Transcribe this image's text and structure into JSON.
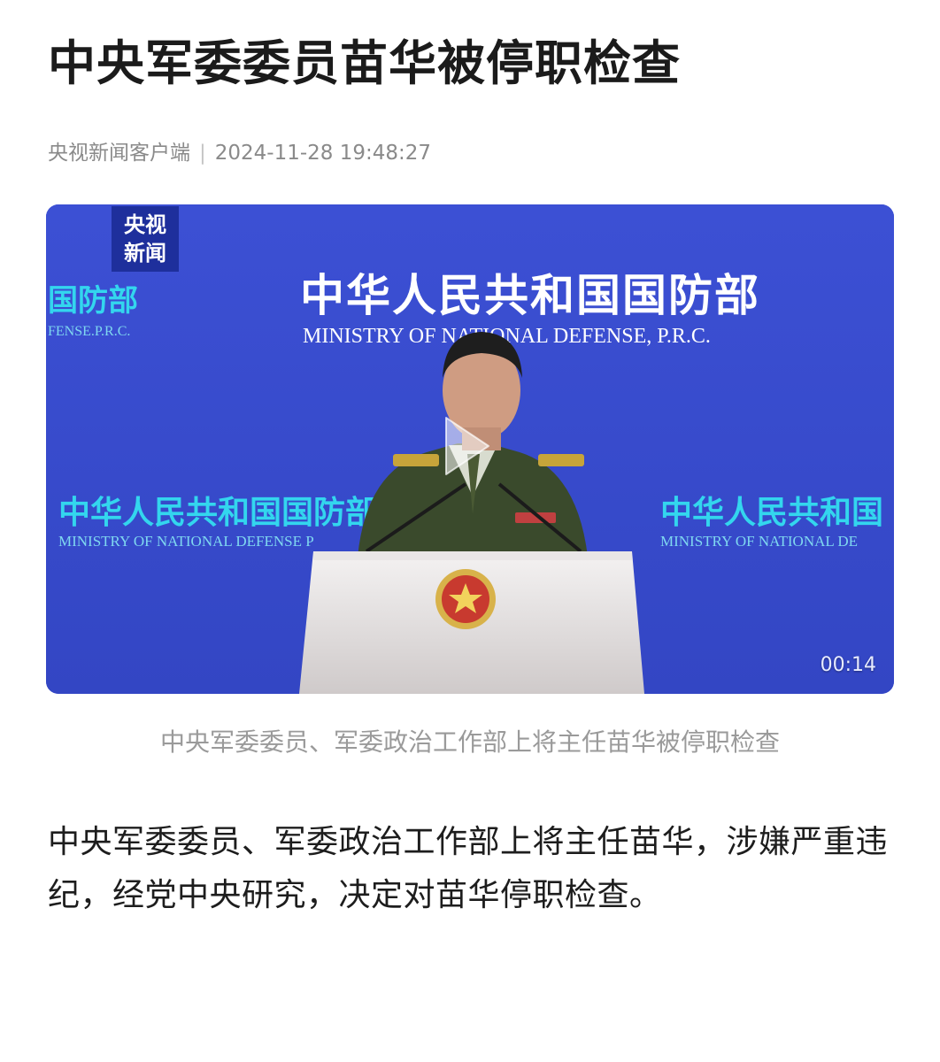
{
  "article": {
    "title": "中央军委委员苗华被停职检查",
    "source": "央视新闻客户端",
    "separator": "|",
    "timestamp": "2024-11-28 19:48:27",
    "body": "中央军委委员、军委政治工作部上将主任苗华，涉嫌严重违纪，经党中央研究，决定对苗华停职检查。"
  },
  "video": {
    "logo_line1": "央视",
    "logo_line2": "新闻",
    "duration": "00:14",
    "caption": "中央军委委员、军委政治工作部上将主任苗华被停职检查",
    "backdrop_title_cn": "中华人民共和国国防部",
    "backdrop_title_en": "MINISTRY OF NATIONAL DEFENSE, P.R.C.",
    "side_left_cn": "国防部",
    "side_left_en": "FENSE.P.R.C.",
    "mid_left_cn": "中华人民共和国国防部",
    "mid_left_en": "MINISTRY OF NATIONAL DEFENSE P",
    "mid_right_cn": "中华人民共和国",
    "mid_right_en": "MINISTRY OF NATIONAL DE",
    "colors": {
      "backdrop": "#3b4fd0",
      "wordmark": "#ffffff",
      "wordmark_cyan": "#33d6ee",
      "logo_bg": "#1e2f9c"
    }
  }
}
